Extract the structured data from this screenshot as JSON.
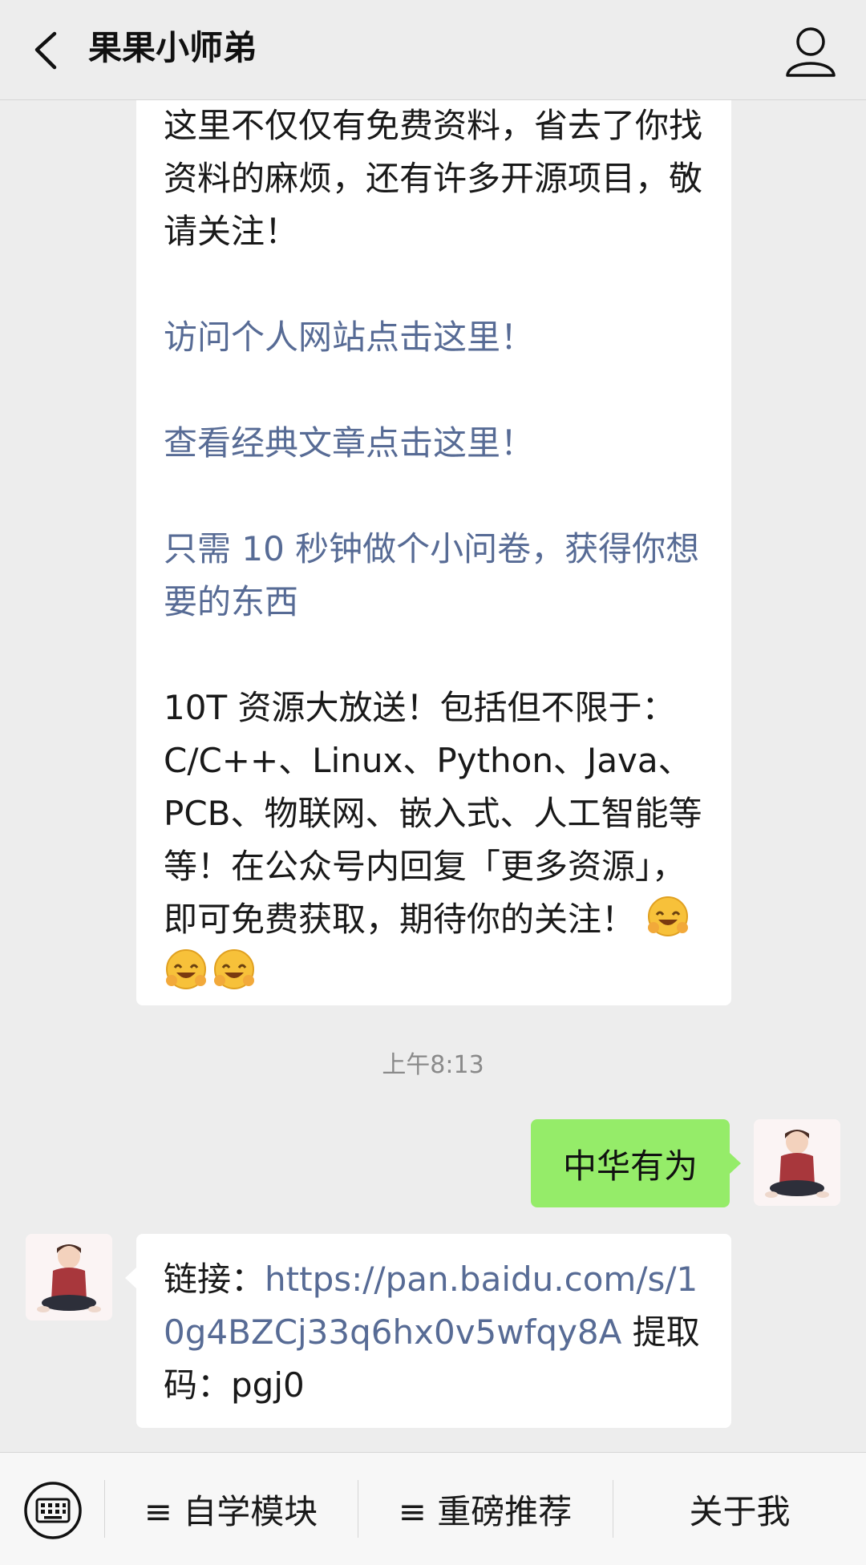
{
  "header": {
    "title": "果果小师弟",
    "back_icon": "chevron-left-icon",
    "profile_icon": "person-icon"
  },
  "article": {
    "intro": "这里不仅仅有免费资料，省去了你找资料的麻烦，还有许多开源项目，敬请关注！",
    "link_site": "访问个人网站点击这里！",
    "link_articles": "查看经典文章点击这里！",
    "link_survey": "只需 10 秒钟做个小问卷，获得你想要的东西",
    "resources": "10T 资源大放送！包括但不限于：C/C++、Linux、Python、Java、PCB、物联网、嵌入式、人工智能等等！在公众号内回复「更多资源」，即可免费获取，期待你的关注！",
    "emoji_icon": "grinning-hug-emoji-icon"
  },
  "timestamp": "上午8:13",
  "my_message": "中华有为",
  "reply": {
    "prefix": "链接：",
    "url": "https://pan.baidu.com/s/10g4BZCj33q6hx0v5wfqy8A",
    "suffix": "提取码：pgj0"
  },
  "menu": {
    "keyboard_icon": "keyboard-icon",
    "item1": "≡ 自学模块",
    "item2": "≡ 重磅推荐",
    "item3": "关于我"
  },
  "colors": {
    "background": "#ededed",
    "link": "#576b95",
    "my_bubble": "#95ec69"
  }
}
